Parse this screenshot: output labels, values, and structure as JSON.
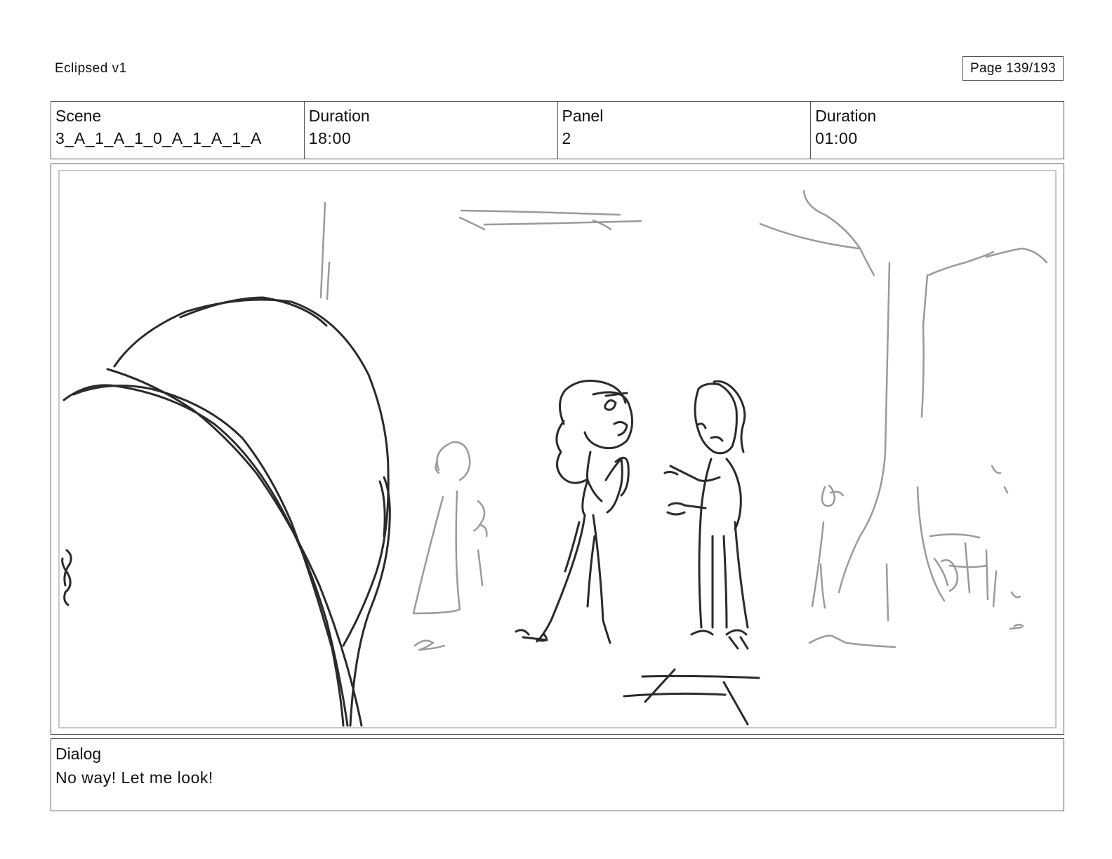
{
  "header": {
    "document_title": "Eclipsed v1",
    "page_indicator": "Page 139/193"
  },
  "info": {
    "scene_label": "Scene",
    "scene_value": "3_A_1_A_1_0_A_1_A_1_A",
    "scene_duration_label": "Duration",
    "scene_duration_value": "18:00",
    "panel_label": "Panel",
    "panel_value": "2",
    "panel_duration_label": "Duration",
    "panel_duration_value": "01:00"
  },
  "dialog": {
    "label": "Dialog",
    "text": "No way! Let me look!"
  }
}
